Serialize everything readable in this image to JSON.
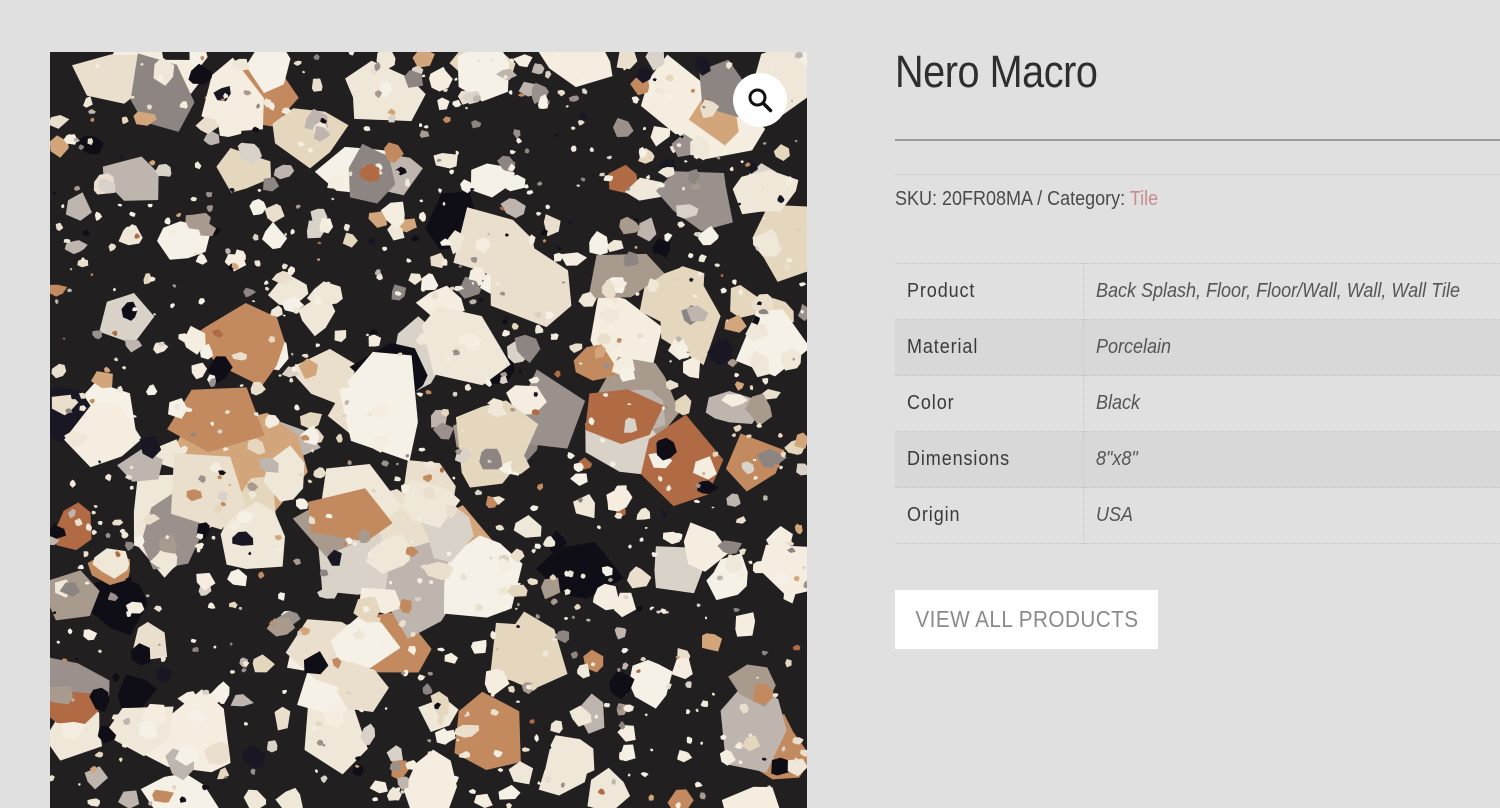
{
  "product": {
    "title": "Nero Macro",
    "sku_label": "SKU:",
    "sku_value": "20FR08MA",
    "separator": "/",
    "category_label": "Category:",
    "category_value": "Tile"
  },
  "attributes": [
    {
      "label": "Product",
      "value": "Back Splash, Floor, Floor/Wall, Wall, Wall Tile"
    },
    {
      "label": "Material",
      "value": "Porcelain"
    },
    {
      "label": "Color",
      "value": "Black"
    },
    {
      "label": "Dimensions",
      "value": "8\"x8\""
    },
    {
      "label": "Origin",
      "value": "USA"
    }
  ],
  "actions": {
    "view_all_label": "VIEW ALL PRODUCTS"
  },
  "gallery": {
    "zoom_icon": "magnifier-icon"
  },
  "colors": {
    "page_background": "#e0e0e0",
    "category_link": "#c98b8d",
    "tile_base": "#1d1a1c"
  }
}
